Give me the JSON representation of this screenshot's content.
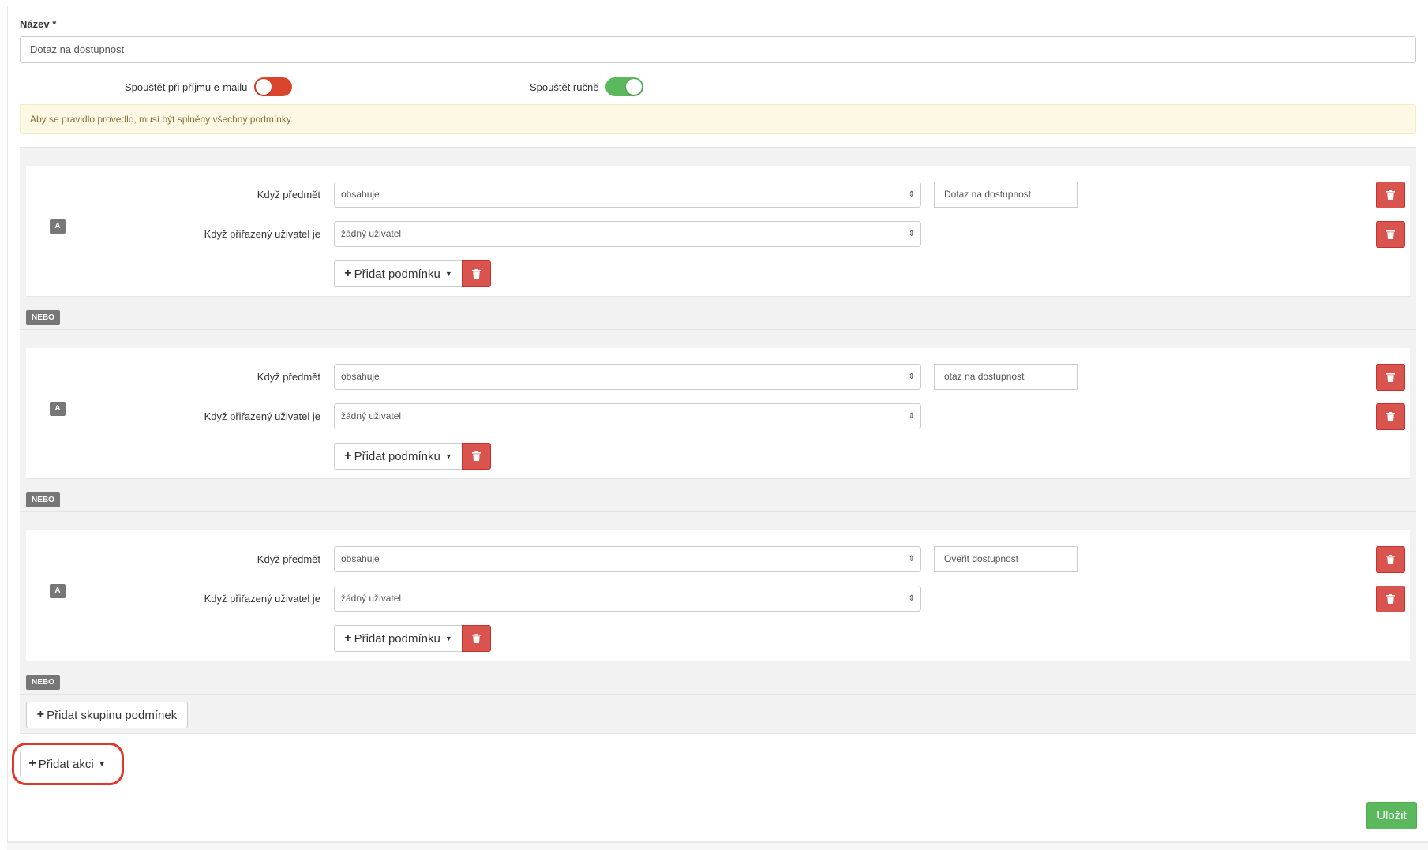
{
  "form": {
    "name_label": "Název *",
    "name_value": "Dotaz na dostupnost",
    "toggle_email_label": "Spouštět při příjmu e-mailu",
    "toggle_email_state": "off",
    "toggle_manual_label": "Spouštět ručně",
    "toggle_manual_state": "on",
    "alert_text": "Aby se pravidlo provedlo, musí být splněny všechny podmínky."
  },
  "groups": [
    {
      "badge": "A",
      "condition1": {
        "label": "Když předmět",
        "operator": "obsahuje",
        "value": "Dotaz na dostupnost"
      },
      "condition2": {
        "label": "Když přiřazený uživatel je",
        "operator": "žádný uživatel"
      },
      "add_condition_label": "Přidat podmínku",
      "separator": "NEBO"
    },
    {
      "badge": "A",
      "condition1": {
        "label": "Když předmět",
        "operator": "obsahuje",
        "value": "otaz na dostupnost"
      },
      "condition2": {
        "label": "Když přiřazený uživatel je",
        "operator": "žádný uživatel"
      },
      "add_condition_label": "Přidat podmínku",
      "separator": "NEBO"
    },
    {
      "badge": "A",
      "condition1": {
        "label": "Když předmět",
        "operator": "obsahuje",
        "value": "Ověřit dostupnost"
      },
      "condition2": {
        "label": "Když přiřazený uživatel je",
        "operator": "žádný uživatel"
      },
      "add_condition_label": "Přidat podmínku",
      "separator": "NEBO"
    }
  ],
  "actions": {
    "add_group_label": "Přidat skupinu podmínek",
    "add_action_label": "Přidat akci",
    "save_label": "Uložit"
  },
  "icons": {
    "plus": "plus-icon",
    "caret": "caret-down-icon",
    "trash": "trash-icon",
    "select_arrows": "select-arrows-icon"
  },
  "colors": {
    "danger": "#d9534f",
    "success": "#5cb85c",
    "toggle_off": "#d9442c",
    "badge": "#777777",
    "alert_bg": "#fcf8e3",
    "highlight": "#e2362b"
  }
}
